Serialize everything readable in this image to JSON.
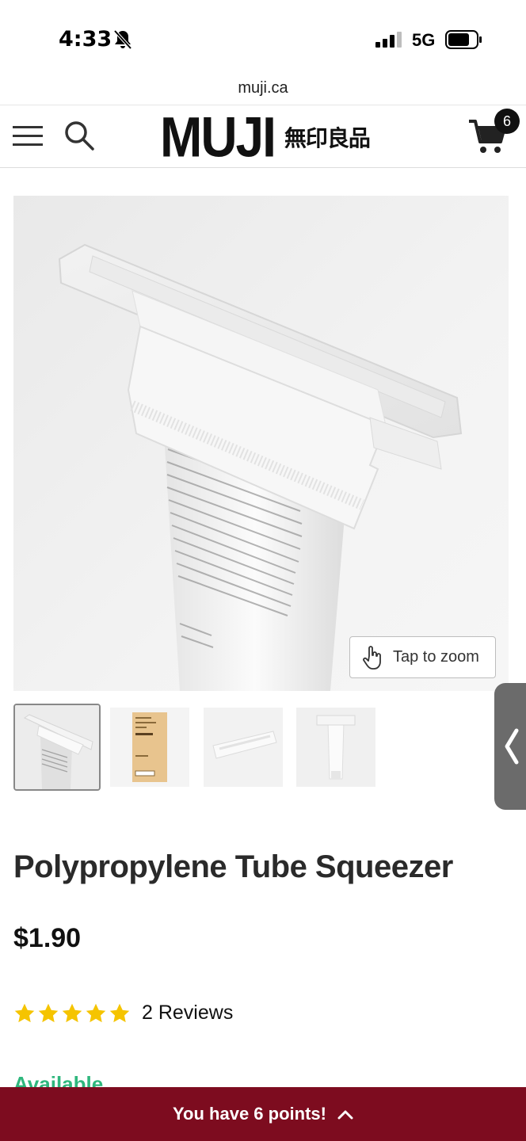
{
  "status_bar": {
    "time": "4:33",
    "network": "5G",
    "icons": [
      "bell-slash-icon",
      "signal-icon",
      "battery-icon"
    ]
  },
  "browser": {
    "url": "muji.ca"
  },
  "header": {
    "logo_text": "MUJI",
    "logo_japanese": "無印良品",
    "cart_count": "6",
    "icons": [
      "menu-icon",
      "search-icon",
      "cart-icon"
    ]
  },
  "gallery": {
    "zoom_label": "Tap to zoom",
    "thumbnail_count": 4,
    "active_thumbnail": 0
  },
  "product": {
    "title": "Polypropylene Tube Squeezer",
    "price": "$1.90",
    "rating": 5,
    "reviews_label": "2 Reviews",
    "availability": "Available"
  },
  "points_bar": {
    "label": "You have 6 points!"
  },
  "colors": {
    "points_bar_bg": "#7d0c1f",
    "star": "#f5c400",
    "available": "#2fb77d"
  }
}
